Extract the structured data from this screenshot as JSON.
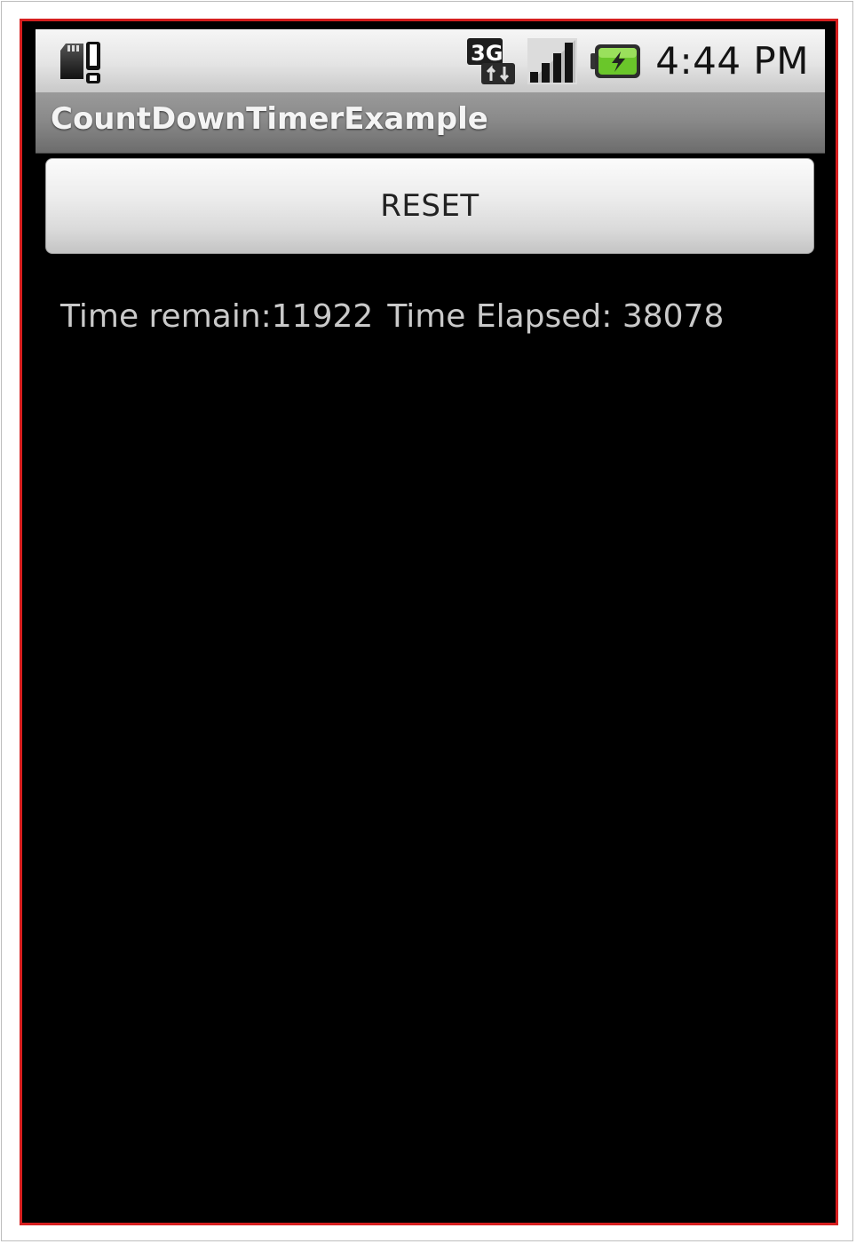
{
  "status_bar": {
    "icons": [
      "sd-card-warning-icon",
      "3g-data-icon",
      "signal-strength-icon",
      "battery-charging-icon"
    ],
    "clock": "4:44 PM"
  },
  "app": {
    "title": "CountDownTimerExample"
  },
  "main": {
    "reset_label": "RESET",
    "time_remain": "Time remain:11922",
    "time_elapsed": "Time Elapsed: 38078"
  },
  "colors": {
    "frame_border": "#d61f1f",
    "background": "#000000",
    "title_text": "#f4f4f4",
    "body_text": "#c9c9c9"
  }
}
